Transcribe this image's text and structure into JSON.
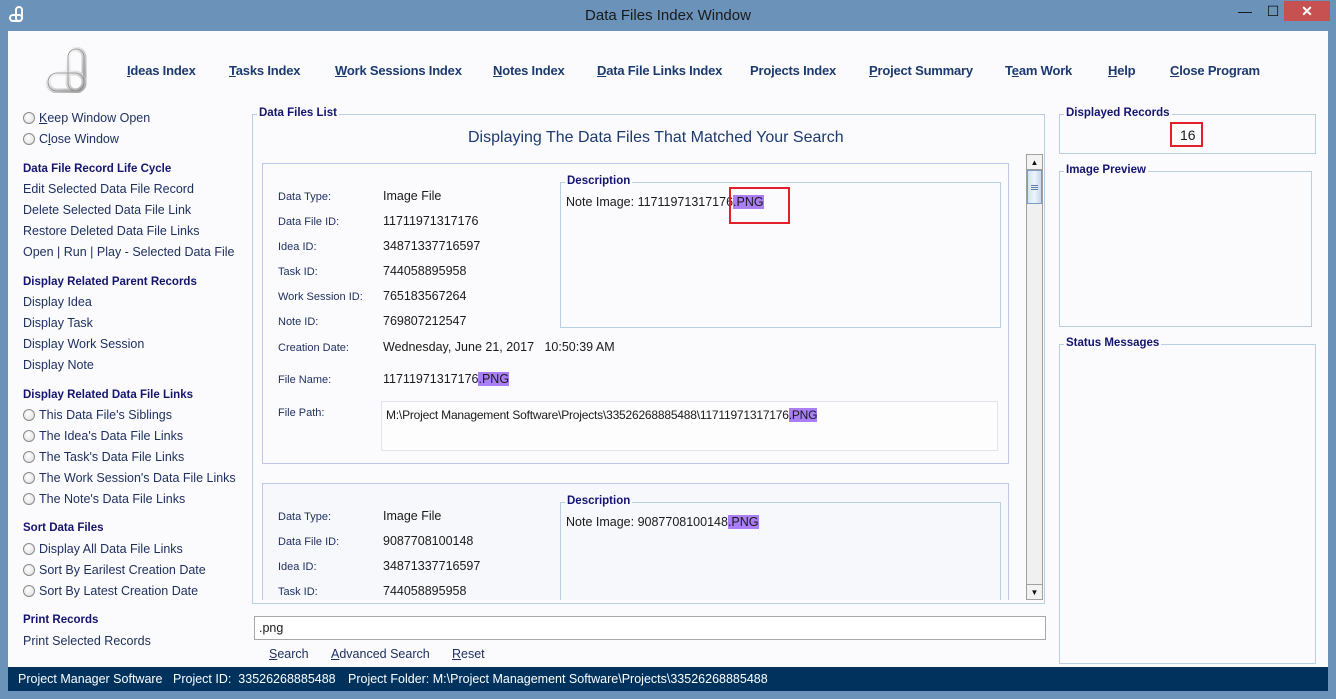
{
  "window": {
    "title": "Data Files Index Window",
    "minimize_glyph": "—",
    "maximize_glyph": "☐",
    "close_glyph": "✕"
  },
  "nav": [
    {
      "key": "I",
      "rest": "deas Index",
      "pre": ""
    },
    {
      "key": "T",
      "rest": "asks Index",
      "pre": ""
    },
    {
      "key": "W",
      "rest": "ork Sessions Index",
      "pre": ""
    },
    {
      "key": "N",
      "rest": "otes Index",
      "pre": ""
    },
    {
      "key": "D",
      "rest": "ata File Links Index",
      "pre": ""
    },
    {
      "key": "",
      "rest": "Projects Index",
      "pre": ""
    },
    {
      "key": "P",
      "rest": "roject Summary",
      "pre": ""
    },
    {
      "key": "e",
      "rest": "am Work",
      "pre": "T"
    },
    {
      "key": "H",
      "rest": "elp",
      "pre": ""
    },
    {
      "key": "C",
      "rest": "lose Program",
      "pre": ""
    }
  ],
  "left_panel": {
    "window_options": [
      {
        "pre": "",
        "key": "K",
        "rest": "eep Window Open"
      },
      {
        "pre": "C",
        "key": "l",
        "rest": "ose Window"
      }
    ],
    "lifecycle_heading": "Data File Record Life Cycle",
    "lifecycle_items": [
      "Edit Selected Data File Record",
      "Delete Selected Data File Link",
      "Restore Deleted Data File Links",
      "Open | Run | Play - Selected Data File"
    ],
    "parent_heading": "Display Related Parent Records",
    "parent_items": [
      "Display Idea",
      "Display Task",
      "Display Work Session",
      "Display Note"
    ],
    "links_heading": "Display Related Data File Links",
    "links_items": [
      "This Data File's Siblings",
      "The Idea's Data File Links",
      "The Task's Data File Links",
      "The Work Session's Data File Links",
      "The Note's Data File Links"
    ],
    "sort_heading": "Sort Data Files",
    "sort_items": [
      "Display All Data File Links",
      "Sort By Earilest Creation Date",
      "Sort By Latest Creation Date"
    ],
    "print_heading": "Print Records",
    "print_items": [
      "Print Selected Records"
    ]
  },
  "main": {
    "group_label": "Data Files List",
    "heading": "Displaying The Data Files That Matched Your Search",
    "field_labels": {
      "data_type": "Data Type:",
      "data_file_id": "Data File ID:",
      "idea_id": "Idea ID:",
      "task_id": "Task ID:",
      "work_session_id": "Work Session ID:",
      "note_id": "Note ID:",
      "creation_date": "Creation Date:",
      "file_name": "File Name:",
      "file_path": "File Path:"
    },
    "description_label": "Description",
    "highlight_term": ".PNG",
    "records": [
      {
        "data_type": "Image File",
        "data_file_id": "11711971317176",
        "idea_id": "34871337716597",
        "task_id": "744058895958",
        "work_session_id": "765183567264",
        "note_id": "769807212547",
        "creation_date": "Wednesday, June 21, 2017   10:50:39 AM",
        "file_name_base": "11711971317176",
        "file_path_base": "M:\\Project Management Software\\Projects\\33526268885488\\11711971317176",
        "description_base": "Note Image: 11711971317176"
      },
      {
        "data_type": "Image File",
        "data_file_id": "9087708100148",
        "idea_id": "34871337716597",
        "task_id": "744058895958",
        "description_base": "Note Image: 9087708100148"
      }
    ]
  },
  "search": {
    "value": ".png",
    "buttons": [
      {
        "pre": "",
        "key": "S",
        "rest": "earch"
      },
      {
        "pre": "",
        "key": "A",
        "rest": "dvanced Search"
      },
      {
        "pre": "",
        "key": "R",
        "rest": "eset"
      }
    ]
  },
  "right_panel": {
    "displayed_records_label": "Displayed Records",
    "displayed_records_value": "16",
    "image_preview_label": "Image Preview",
    "status_messages_label": "Status Messages"
  },
  "statusbar": {
    "app_name": "Project Manager Software",
    "project_id": "Project ID:  33526268885488",
    "project_folder": "Project Folder: M:\\Project Management Software\\Projects\\33526268885488"
  },
  "colors": {
    "frame": "#6b92b8",
    "close_button": "#c75050",
    "statusbar": "#00325e",
    "highlight": "#a97ef7",
    "callout": "#e3202a",
    "nav_text": "#1c3a6e"
  }
}
